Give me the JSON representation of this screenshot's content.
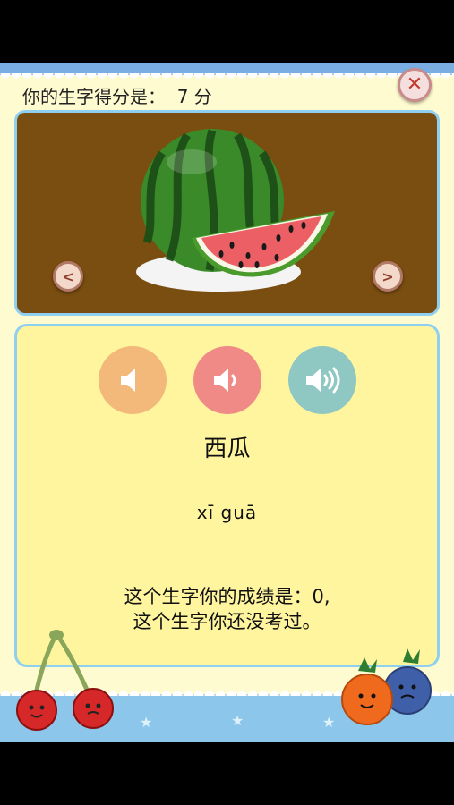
{
  "header": {
    "score_text": "你的生字得分是：  7 分",
    "close_icon": "close-icon"
  },
  "image_panel": {
    "picture": "watermelon-illustration",
    "prev_label": "<",
    "next_label": ">"
  },
  "sound_buttons": [
    {
      "icon": "speaker-mute-icon",
      "color": "#f2b97a"
    },
    {
      "icon": "speaker-low-icon",
      "color": "#f08a86"
    },
    {
      "icon": "speaker-high-icon",
      "color": "#8fc7c2"
    }
  ],
  "word": {
    "characters": "西瓜",
    "pinyin": "xī  guā"
  },
  "result": {
    "line1": "这个生字你的成绩是：0,",
    "line2": "这个生字你还没考过。"
  },
  "colors": {
    "background": "#fffbd0",
    "image_bg": "#7a4d10",
    "panel_border": "#8fd0f0",
    "info_bg": "#fff59e",
    "band": "#8cc6ea"
  }
}
